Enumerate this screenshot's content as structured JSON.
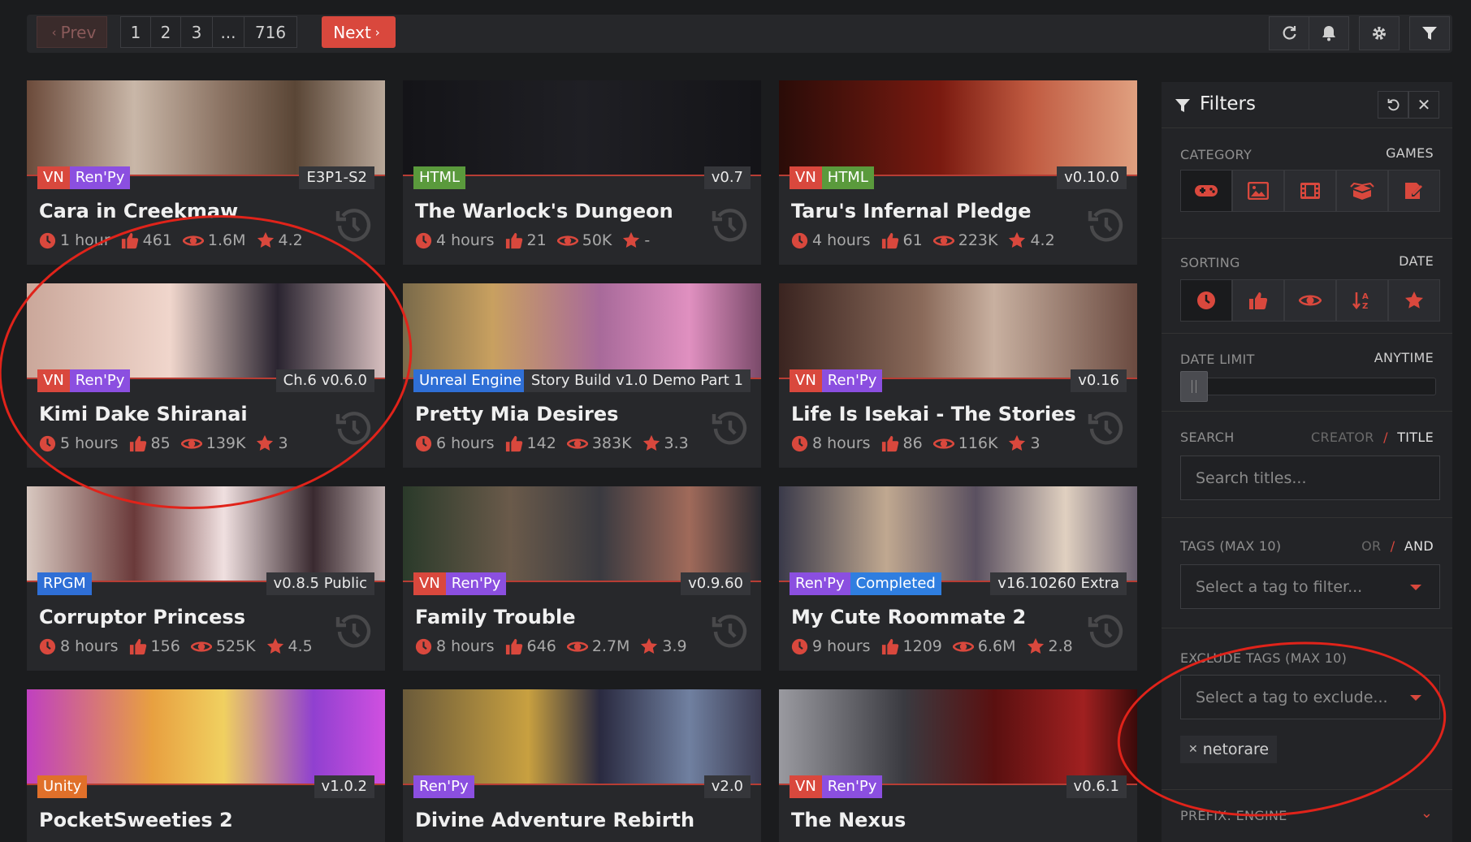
{
  "pagination": {
    "prev": "Prev",
    "pages": [
      "1",
      "2",
      "3",
      "...",
      "716"
    ],
    "next": "Next"
  },
  "cards": [
    {
      "tags": [
        {
          "t": "VN",
          "c": "#d9483d"
        },
        {
          "t": "Ren'Py",
          "c": "#8b4fe0"
        }
      ],
      "version": "E3P1-S2",
      "title": "Cara in Creekmaw",
      "time": "1 hour",
      "likes": "461",
      "views": "1.6M",
      "rating": "4.2",
      "thumb": "linear-gradient(90deg,#6b4a3a,#c9b7a8 30%,#8a7262 55%,#5a4636 75%,#b9a89a)"
    },
    {
      "tags": [
        {
          "t": "HTML",
          "c": "#5a9a3c"
        }
      ],
      "version": "v0.7",
      "title": "The Warlock's Dungeon",
      "time": "4 hours",
      "likes": "21",
      "views": "50K",
      "rating": "-",
      "thumb": "linear-gradient(90deg,#141418,#1f1f24 50%,#141418)"
    },
    {
      "tags": [
        {
          "t": "VN",
          "c": "#d9483d"
        },
        {
          "t": "HTML",
          "c": "#5a9a3c"
        }
      ],
      "version": "v0.10.0",
      "title": "Taru's Infernal Pledge",
      "time": "4 hours",
      "likes": "61",
      "views": "223K",
      "rating": "4.2",
      "thumb": "linear-gradient(90deg,#2a0c08,#7a1a10 45%,#c05a40 70%,#e0a080)"
    },
    {
      "tags": [
        {
          "t": "VN",
          "c": "#d9483d"
        },
        {
          "t": "Ren'Py",
          "c": "#8b4fe0"
        }
      ],
      "version": "Ch.6 v0.6.0",
      "title": "Kimi Dake Shiranai",
      "time": "5 hours",
      "likes": "85",
      "views": "139K",
      "rating": "3",
      "thumb": "linear-gradient(90deg,#caa79a,#f0d6cc 40%,#2a2430 70%,#d8c0c0)"
    },
    {
      "tags": [
        {
          "t": "Unreal Engine",
          "c": "#2f6fd6"
        }
      ],
      "version": "Story Build v1.0 Demo Part 1",
      "title": "Pretty Mia Desires",
      "time": "6 hours",
      "likes": "142",
      "views": "383K",
      "rating": "3.3",
      "thumb": "linear-gradient(90deg,#7a6a4a,#c8a060 25%,#a86a9a 55%,#e090c0 80%,#7a4a6a)"
    },
    {
      "tags": [
        {
          "t": "VN",
          "c": "#d9483d"
        },
        {
          "t": "Ren'Py",
          "c": "#8b4fe0"
        }
      ],
      "version": "v0.16",
      "title": "Life Is Isekai - The Stories",
      "time": "8 hours",
      "likes": "86",
      "views": "116K",
      "rating": "3",
      "thumb": "linear-gradient(90deg,#3a2420,#8a6a5a 40%,#c8b0a0 60%,#6a4a40)"
    },
    {
      "tags": [
        {
          "t": "RPGM",
          "c": "#2f6fd6"
        }
      ],
      "version": "v0.8.5 Public",
      "title": "Corruptor Princess",
      "time": "8 hours",
      "likes": "156",
      "views": "525K",
      "rating": "4.5",
      "thumb": "linear-gradient(90deg,#d8c8c0,#6a3a3a 30%,#f0e0e0 55%,#3a2a30 80%,#c0b0b0)"
    },
    {
      "tags": [
        {
          "t": "VN",
          "c": "#d9483d"
        },
        {
          "t": "Ren'Py",
          "c": "#8b4fe0"
        }
      ],
      "version": "v0.9.60",
      "title": "Family Trouble",
      "time": "8 hours",
      "likes": "646",
      "views": "2.7M",
      "rating": "3.9",
      "thumb": "linear-gradient(90deg,#2a3a2a,#6a5a4a 30%,#3a3a40 55%,#a06a5a 80%,#2a2a30)"
    },
    {
      "tags": [
        {
          "t": "Ren'Py",
          "c": "#8b4fe0"
        },
        {
          "t": "Completed",
          "c": "#2f7ee0"
        }
      ],
      "version": "v16.10260 Extra",
      "title": "My Cute Roommate 2",
      "time": "9 hours",
      "likes": "1209",
      "views": "6.6M",
      "rating": "2.8",
      "thumb": "linear-gradient(90deg,#3a3a4a,#c0a890 30%,#5a5060 55%,#e0d0c0 80%,#6a6070)"
    },
    {
      "tags": [
        {
          "t": "Unity",
          "c": "#e0702a"
        }
      ],
      "version": "v1.0.2",
      "title": "PocketSweeties 2",
      "time": "",
      "likes": "",
      "views": "",
      "rating": "",
      "thumb": "linear-gradient(90deg,#c040c0,#e8a040 35%,#f0d060 55%,#9040d0 80%,#d050e0)"
    },
    {
      "tags": [
        {
          "t": "Ren'Py",
          "c": "#8b4fe0"
        }
      ],
      "version": "v2.0",
      "title": "Divine Adventure Rebirth",
      "time": "",
      "likes": "",
      "views": "",
      "rating": "",
      "thumb": "linear-gradient(90deg,#6a5a3a,#c8a040 35%,#2a2a40 55%,#7080a0 80%,#3a3a50)"
    },
    {
      "tags": [
        {
          "t": "VN",
          "c": "#d9483d"
        },
        {
          "t": "Ren'Py",
          "c": "#8b4fe0"
        }
      ],
      "version": "v0.6.1",
      "title": "The Nexus",
      "time": "",
      "likes": "",
      "views": "",
      "rating": "",
      "thumb": "linear-gradient(90deg,#9a9aa0,#3a3a40 35%,#5a1010 60%,#a02020 85%,#3a0a0a)"
    }
  ],
  "filters": {
    "title": "Filters",
    "category": {
      "label": "CATEGORY",
      "value": "GAMES"
    },
    "sorting": {
      "label": "SORTING",
      "value": "DATE"
    },
    "date_limit": {
      "label": "DATE LIMIT",
      "value": "ANYTIME"
    },
    "search": {
      "label": "SEARCH",
      "mode_a": "CREATOR",
      "sep": "/",
      "mode_b": "TITLE",
      "placeholder": "Search titles..."
    },
    "tags": {
      "label": "TAGS (MAX 10)",
      "mode_a": "OR",
      "sep": "/",
      "mode_b": "AND",
      "placeholder": "Select a tag to filter..."
    },
    "exclude": {
      "label": "EXCLUDE TAGS (MAX 10)",
      "placeholder": "Select a tag to exclude...",
      "chip": "netorare"
    },
    "prefix": {
      "label": "PREFIX: ENGINE"
    }
  },
  "colors": {
    "accent": "#d9483d",
    "annotation": "#e0231a"
  }
}
